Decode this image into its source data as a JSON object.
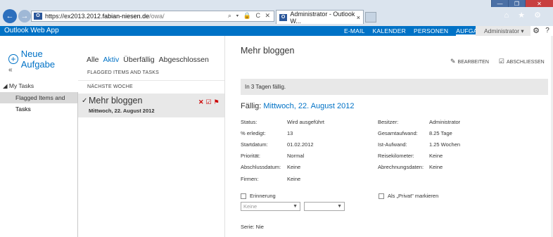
{
  "browser": {
    "url_prefix": "https://ex2013.2012.",
    "url_domain": "fabian-niesen.de",
    "url_path": "/owa/",
    "address_actions": "⌕ ▾ 🔒 C ✕",
    "tab_title": "Administrator - Outlook W...",
    "tab_close": "×",
    "window_min": "—",
    "window_max": "❐",
    "window_close": "✕",
    "toolbar_icons": "⌂ ★ ⚙",
    "page_icon": "O"
  },
  "owa": {
    "brand": "Outlook Web App",
    "nav": [
      "E-MAIL",
      "KALENDER",
      "PERSONEN",
      "AUFGABEN"
    ],
    "user": "Administrator ▾",
    "gear": "⚙",
    "help": "?"
  },
  "left": {
    "new_task": "Neue Aufgabe",
    "collapse": "«",
    "group": "◢ My Tasks",
    "items": [
      "Flagged Items and Tasks",
      "Tasks"
    ]
  },
  "middle": {
    "filters": [
      "Alle",
      "Aktiv",
      "Überfällig",
      "Abgeschlossen"
    ],
    "subtitle": "FLAGGED ITEMS AND TASKS",
    "section": "NÄCHSTE WOCHE",
    "task": {
      "check": "✓",
      "name": "Mehr bloggen",
      "date": "Mittwoch, 22. August 2012"
    }
  },
  "detail": {
    "title": "Mehr bloggen",
    "edit_label": "BEARBEITEN",
    "complete_label": "ABSCHLIESSEN",
    "more": "···",
    "due_banner": "In 3 Tagen fällig.",
    "due_label": "Fällig: ",
    "due_value": "Mittwoch, 22. August 2012",
    "fields_left": [
      {
        "label": "Status:",
        "value": "Wird ausgeführt"
      },
      {
        "label": "% erledigt:",
        "value": "13"
      },
      {
        "label": "Startdatum:",
        "value": "01.02.2012"
      },
      {
        "label": "Priorität:",
        "value": "Normal"
      },
      {
        "label": "Abschlussdatum:",
        "value": "Keine"
      },
      {
        "label": "Firmen:",
        "value": "Keine"
      }
    ],
    "fields_right": [
      {
        "label": "Besitzer:",
        "value": "Administrator"
      },
      {
        "label": "Gesamtaufwand:",
        "value": "8.25 Tage"
      },
      {
        "label": "Ist-Aufwand:",
        "value": "1.25 Wochen"
      },
      {
        "label": "Reisekilometer:",
        "value": "Keine"
      },
      {
        "label": "Abrechnungsdaten:",
        "value": "Keine"
      }
    ],
    "reminder_label": "Erinnerung",
    "private_label": "Als „Privat\" markieren",
    "reminder_date": "Keine",
    "reminder_time": "",
    "series": "Serie: Nie"
  },
  "colors": {
    "accent": "#0072c6",
    "flag": "#cc0000"
  }
}
